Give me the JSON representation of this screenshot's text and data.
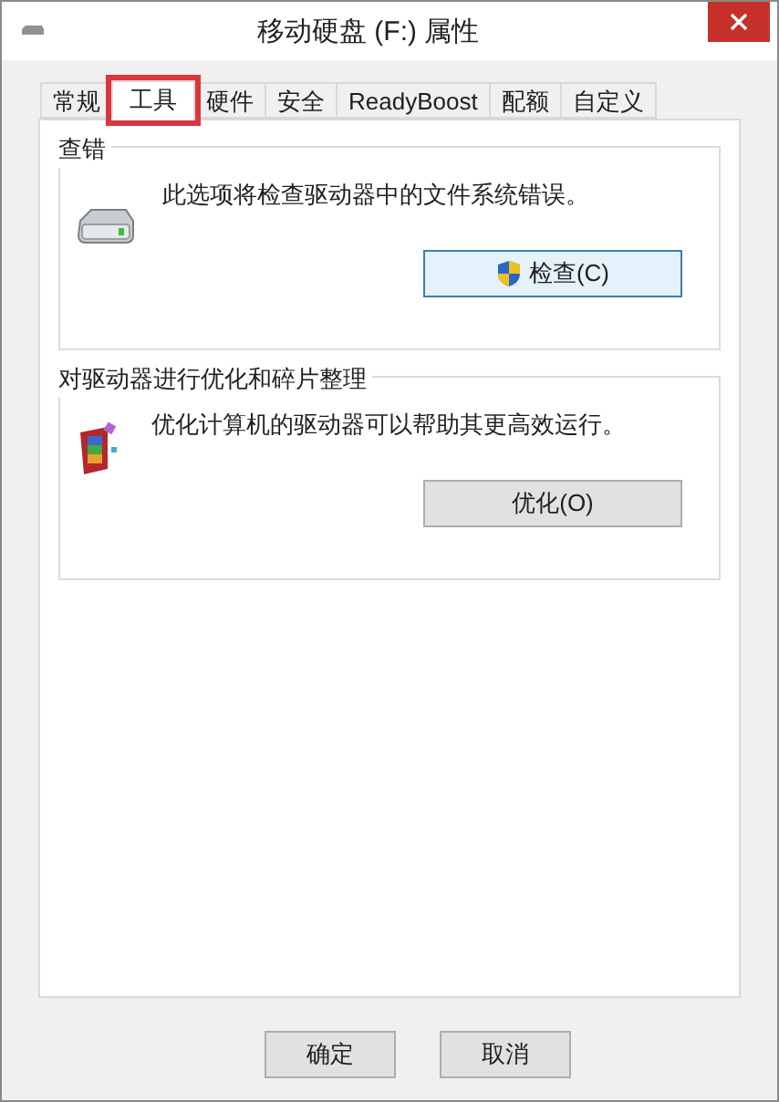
{
  "window": {
    "title": "移动硬盘 (F:) 属性"
  },
  "tabs": [
    {
      "label": "常规",
      "selected": false,
      "highlighted": false
    },
    {
      "label": "工具",
      "selected": true,
      "highlighted": true
    },
    {
      "label": "硬件",
      "selected": false,
      "highlighted": false
    },
    {
      "label": "安全",
      "selected": false,
      "highlighted": false
    },
    {
      "label": "ReadyBoost",
      "selected": false,
      "highlighted": false
    },
    {
      "label": "配额",
      "selected": false,
      "highlighted": false
    },
    {
      "label": "自定义",
      "selected": false,
      "highlighted": false
    }
  ],
  "groups": [
    {
      "kind": "check",
      "title": "查错",
      "description": "此选项将检查驱动器中的文件系统错误。",
      "button": "检查(C)",
      "shield": true
    },
    {
      "kind": "optimize",
      "title": "对驱动器进行优化和碎片整理",
      "description": "优化计算机的驱动器可以帮助其更高效运行。",
      "button": "优化(O)",
      "shield": false
    }
  ],
  "buttons": [
    "确定",
    "取消"
  ]
}
